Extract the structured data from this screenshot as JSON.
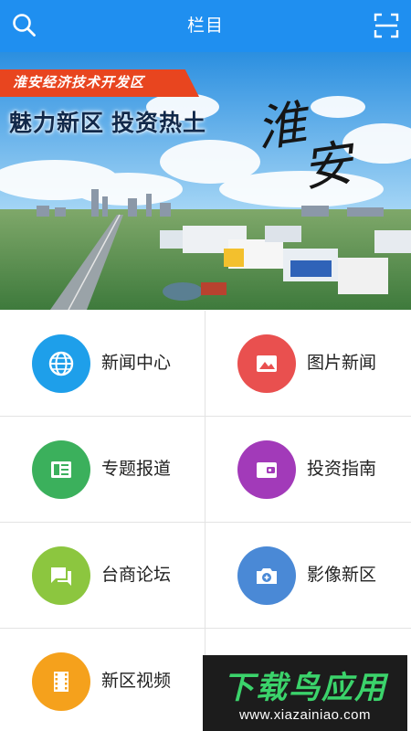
{
  "header": {
    "title": "栏目",
    "left_icon": "search-icon",
    "right_icon": "scan-icon"
  },
  "banner": {
    "ribbon_text": "淮安经济技术开发区",
    "slogan": "魅力新区  投资热土",
    "calligraphy": [
      "淮",
      "安"
    ]
  },
  "menu": [
    {
      "label": "新闻中心",
      "icon": "globe-icon",
      "color": "#1e9fea"
    },
    {
      "label": "图片新闻",
      "icon": "image-icon",
      "color": "#e9504f"
    },
    {
      "label": "专题报道",
      "icon": "newspaper-icon",
      "color": "#3bb05c"
    },
    {
      "label": "投资指南",
      "icon": "wallet-icon",
      "color": "#a23ab9"
    },
    {
      "label": "台商论坛",
      "icon": "chat-icon",
      "color": "#8cc63f"
    },
    {
      "label": "影像新区",
      "icon": "camera-icon",
      "color": "#4a89d6"
    },
    {
      "label": "新区视频",
      "icon": "film-icon",
      "color": "#f5a11c"
    }
  ],
  "watermark": {
    "title": "下载鸟应用",
    "url": "www.xiazainiao.com"
  },
  "colors": {
    "header_bg": "#1f8ff0",
    "ribbon_bg": "#e8451f",
    "watermark_green": "#3bd36b"
  }
}
